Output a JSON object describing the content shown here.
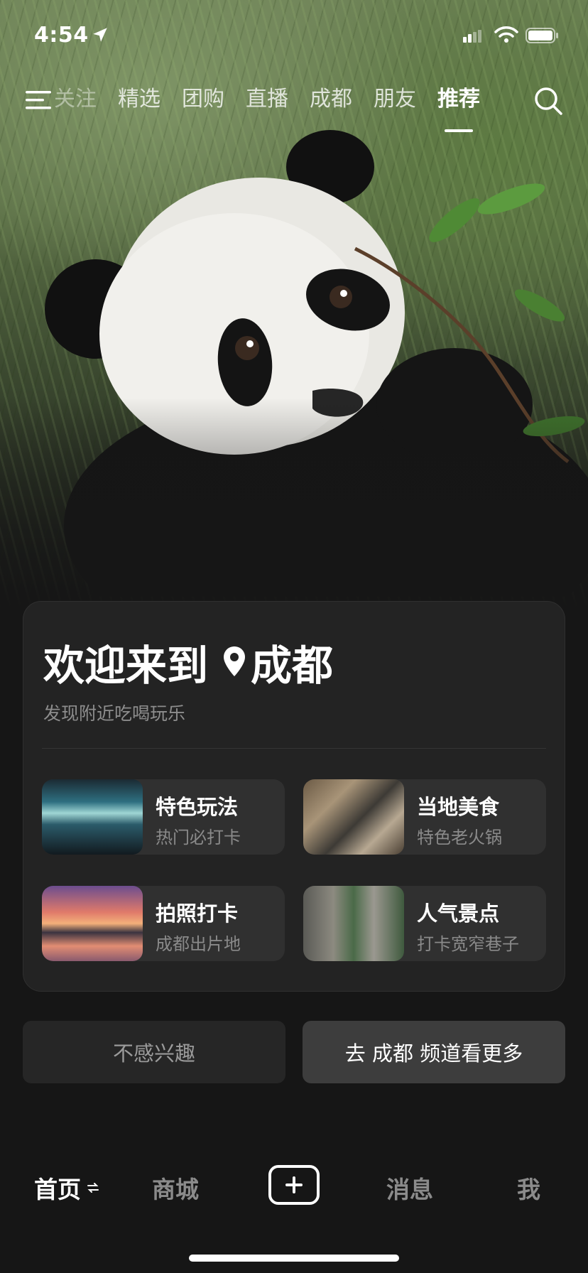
{
  "status_bar": {
    "time": "4:54"
  },
  "top_nav": {
    "tabs": [
      {
        "label": "关注"
      },
      {
        "label": "精选"
      },
      {
        "label": "团购"
      },
      {
        "label": "直播"
      },
      {
        "label": "成都"
      },
      {
        "label": "朋友"
      },
      {
        "label": "推荐"
      }
    ],
    "active_tab": "推荐"
  },
  "welcome_card": {
    "title_prefix": "欢迎来到",
    "city": "成都",
    "subtitle": "发现附近吃喝玩乐",
    "tiles": [
      {
        "title": "特色玩法",
        "subtitle": "热门必打卡"
      },
      {
        "title": "当地美食",
        "subtitle": "特色老火锅"
      },
      {
        "title": "拍照打卡",
        "subtitle": "成都出片地"
      },
      {
        "title": "人气景点",
        "subtitle": "打卡宽窄巷子"
      }
    ]
  },
  "actions": {
    "not_interested": "不感兴趣",
    "go_channel": "去 成都 频道看更多"
  },
  "bottom_nav": {
    "home": "首页",
    "mall": "商城",
    "messages": "消息",
    "me": "我"
  }
}
